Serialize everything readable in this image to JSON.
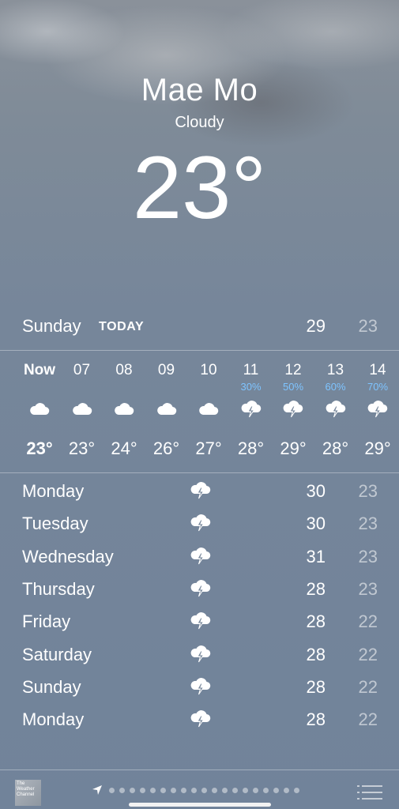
{
  "location": {
    "city": "Mae Mo",
    "condition": "Cloudy",
    "temperature": "23°"
  },
  "today": {
    "day": "Sunday",
    "tag": "TODAY",
    "high": "29",
    "low": "23"
  },
  "hourly": [
    {
      "time": "Now",
      "pop": "",
      "icon": "cloud-icon",
      "temp": "23°"
    },
    {
      "time": "07",
      "pop": "",
      "icon": "cloud-icon",
      "temp": "23°"
    },
    {
      "time": "08",
      "pop": "",
      "icon": "cloud-icon",
      "temp": "24°"
    },
    {
      "time": "09",
      "pop": "",
      "icon": "cloud-icon",
      "temp": "26°"
    },
    {
      "time": "10",
      "pop": "",
      "icon": "cloud-icon",
      "temp": "27°"
    },
    {
      "time": "11",
      "pop": "30%",
      "icon": "thunderstorm-icon",
      "temp": "28°"
    },
    {
      "time": "12",
      "pop": "50%",
      "icon": "thunderstorm-icon",
      "temp": "29°"
    },
    {
      "time": "13",
      "pop": "60%",
      "icon": "thunderstorm-icon",
      "temp": "28°"
    },
    {
      "time": "14",
      "pop": "70%",
      "icon": "thunderstorm-icon",
      "temp": "29°"
    }
  ],
  "daily": [
    {
      "day": "Monday",
      "icon": "thunderstorm-icon",
      "high": "30",
      "low": "23"
    },
    {
      "day": "Tuesday",
      "icon": "thunderstorm-icon",
      "high": "30",
      "low": "23"
    },
    {
      "day": "Wednesday",
      "icon": "thunderstorm-icon",
      "high": "31",
      "low": "23"
    },
    {
      "day": "Thursday",
      "icon": "thunderstorm-icon",
      "high": "28",
      "low": "23"
    },
    {
      "day": "Friday",
      "icon": "thunderstorm-icon",
      "high": "28",
      "low": "22"
    },
    {
      "day": "Saturday",
      "icon": "thunderstorm-icon",
      "high": "28",
      "low": "22"
    },
    {
      "day": "Sunday",
      "icon": "thunderstorm-icon",
      "high": "28",
      "low": "22"
    },
    {
      "day": "Monday",
      "icon": "thunderstorm-icon",
      "high": "28",
      "low": "22"
    }
  ],
  "footer": {
    "logo_text": "The Weather Channel",
    "page_count": 19,
    "current_page": 0
  },
  "colors": {
    "pop_text": "#7ec4ff",
    "low_temp_opacity": "0.55"
  }
}
